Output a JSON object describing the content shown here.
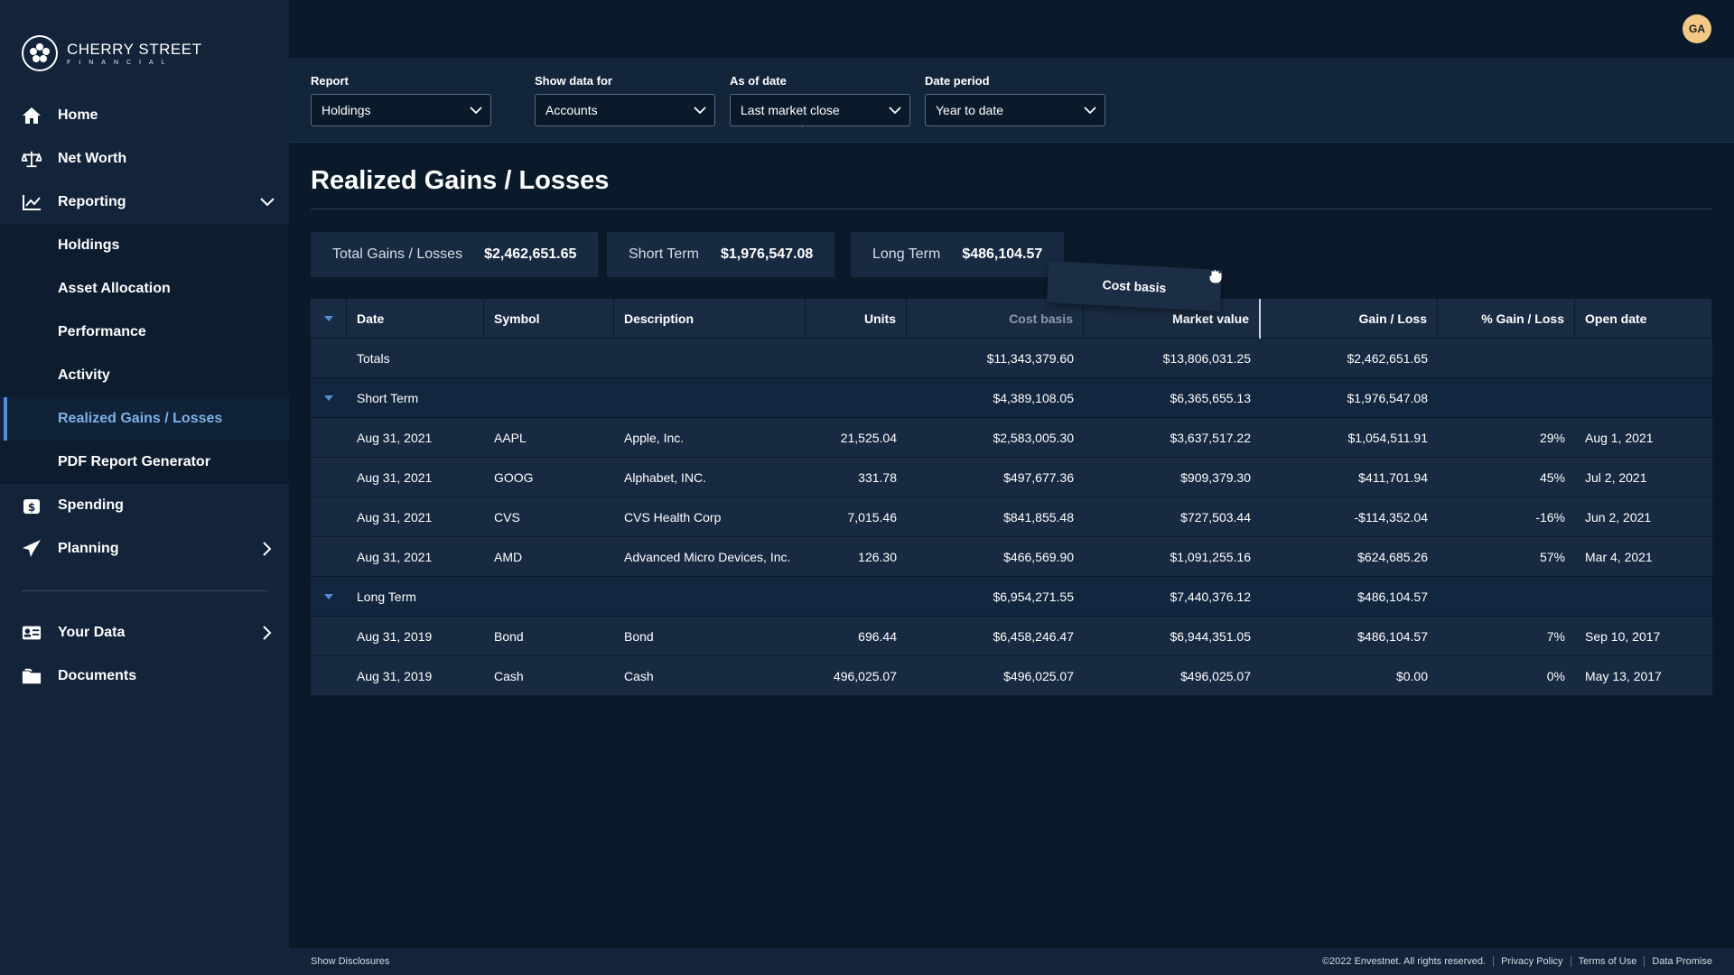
{
  "brand": {
    "line1": "CHERRY STREET",
    "line2": "FINANCIAL"
  },
  "user": {
    "initials": "GA"
  },
  "sidebar": {
    "home": "Home",
    "net_worth": "Net Worth",
    "reporting": "Reporting",
    "reporting_items": [
      "Holdings",
      "Asset Allocation",
      "Performance",
      "Activity",
      "Realized Gains / Losses",
      "PDF Report Generator"
    ],
    "spending": "Spending",
    "planning": "Planning",
    "your_data": "Your Data",
    "documents": "Documents"
  },
  "filters": {
    "report": {
      "label": "Report",
      "value": "Holdings"
    },
    "show_data_for": {
      "label": "Show data for",
      "value": "Accounts"
    },
    "as_of_date": {
      "label": "As of date",
      "value": "Last market close"
    },
    "date_period": {
      "label": "Date period",
      "value": "Year to date"
    }
  },
  "page": {
    "title": "Realized Gains / Losses"
  },
  "summary": {
    "total": {
      "label": "Total Gains / Losses",
      "value": "$2,462,651.65"
    },
    "short": {
      "label": "Short Term",
      "value": "$1,976,547.08"
    },
    "long": {
      "label": "Long Term",
      "value": "$486,104.57"
    }
  },
  "drag_ghost": "Cost basis",
  "table": {
    "headers": [
      "Date",
      "Symbol",
      "Description",
      "Units",
      "Cost basis",
      "Market value",
      "Gain / Loss",
      "% Gain / Loss",
      "Open date"
    ],
    "totals": {
      "label": "Totals",
      "cost": "$11,343,379.60",
      "market": "$13,806,031.25",
      "gain": "$2,462,651.65"
    },
    "short_group": {
      "label": "Short Term",
      "cost": "$4,389,108.05",
      "market": "$6,365,655.13",
      "gain": "$1,976,547.08"
    },
    "short_rows": [
      {
        "date": "Aug 31, 2021",
        "symbol": "AAPL",
        "desc": "Apple, Inc.",
        "units": "21,525.04",
        "cost": "$2,583,005.30",
        "market": "$3,637,517.22",
        "gain": "$1,054,511.91",
        "pct": "29%",
        "open": "Aug 1, 2021"
      },
      {
        "date": "Aug 31, 2021",
        "symbol": "GOOG",
        "desc": "Alphabet, INC.",
        "units": "331.78",
        "cost": "$497,677.36",
        "market": "$909,379.30",
        "gain": "$411,701.94",
        "pct": "45%",
        "open": "Jul 2, 2021"
      },
      {
        "date": "Aug 31, 2021",
        "symbol": "CVS",
        "desc": "CVS Health Corp",
        "units": "7,015.46",
        "cost": "$841,855.48",
        "market": "$727,503.44",
        "gain": "-$114,352.04",
        "pct": "-16%",
        "open": "Jun 2, 2021"
      },
      {
        "date": "Aug 31, 2021",
        "symbol": "AMD",
        "desc": "Advanced Micro Devices, Inc.",
        "units": "126.30",
        "cost": "$466,569.90",
        "market": "$1,091,255.16",
        "gain": "$624,685.26",
        "pct": "57%",
        "open": "Mar 4, 2021"
      }
    ],
    "long_group": {
      "label": "Long Term",
      "cost": "$6,954,271.55",
      "market": "$7,440,376.12",
      "gain": "$486,104.57"
    },
    "long_rows": [
      {
        "date": "Aug 31, 2019",
        "symbol": "Bond",
        "desc": "Bond",
        "units": "696.44",
        "cost": "$6,458,246.47",
        "market": "$6,944,351.05",
        "gain": "$486,104.57",
        "pct": "7%",
        "open": "Sep 10, 2017"
      },
      {
        "date": "Aug 31, 2019",
        "symbol": "Cash",
        "desc": "Cash",
        "units": "496,025.07",
        "cost": "$496,025.07",
        "market": "$496,025.07",
        "gain": "$0.00",
        "pct": "0%",
        "open": "May 13, 2017"
      }
    ]
  },
  "footer": {
    "disclosures": "Show Disclosures",
    "copyright": "©2022 Envestnet. All rights reserved.",
    "privacy": "Privacy Policy",
    "terms": "Terms of Use",
    "data_promise": "Data Promise"
  }
}
